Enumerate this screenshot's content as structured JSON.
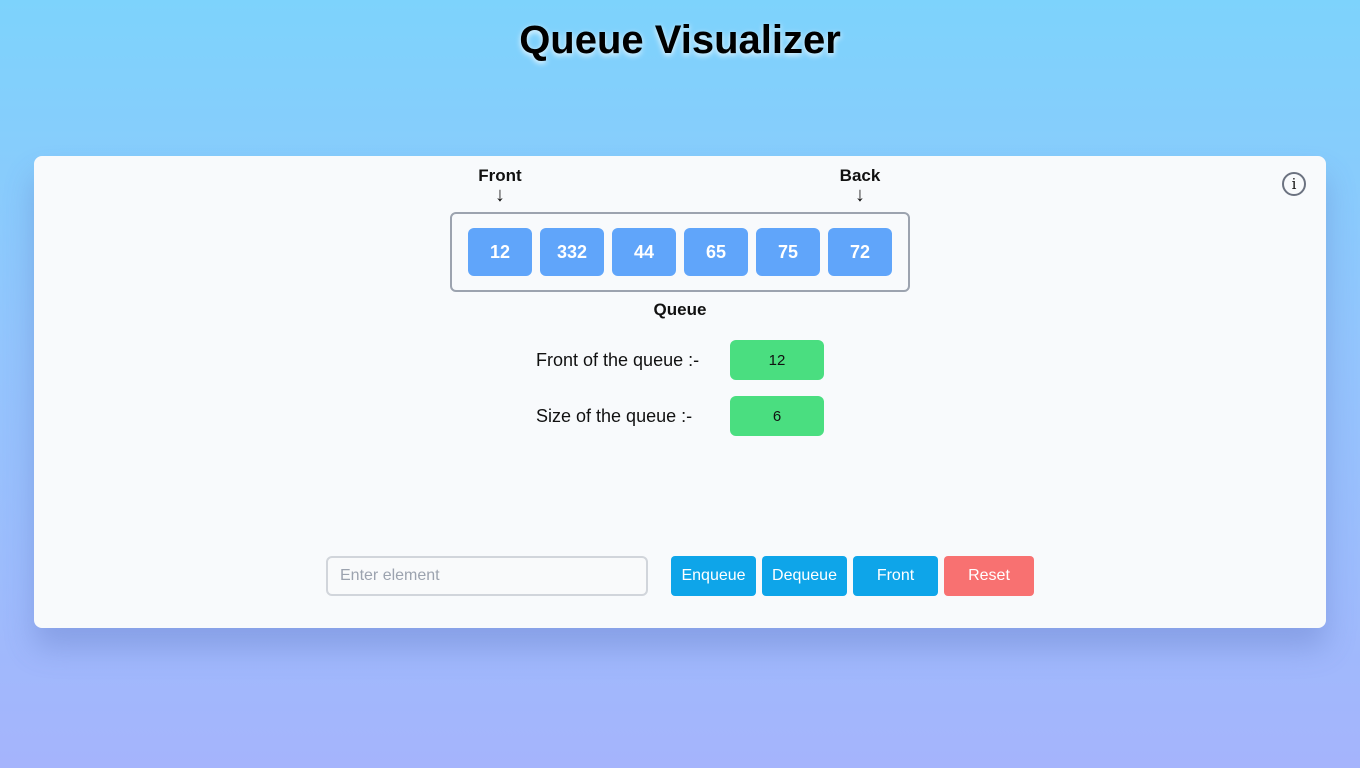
{
  "page": {
    "title": "Queue Visualizer"
  },
  "info": {
    "icon": "info-icon",
    "glyph": "i"
  },
  "pointers": {
    "front_label": "Front",
    "back_label": "Back",
    "arrow": "↓"
  },
  "queue": {
    "items": [
      "12",
      "332",
      "44",
      "65",
      "75",
      "72"
    ],
    "label": "Queue"
  },
  "stats": {
    "front_label": "Front of the queue :-",
    "front_value": "12",
    "size_label": "Size of the queue :-",
    "size_value": "6"
  },
  "controls": {
    "input_placeholder": "Enter element",
    "input_value": "",
    "enqueue_label": "Enqueue",
    "dequeue_label": "Dequeue",
    "front_label": "Front",
    "reset_label": "Reset"
  },
  "colors": {
    "queue_cell": "#60a5fa",
    "stat_value": "#4ade80",
    "action_button": "#0ea5e9",
    "reset_button": "#f87171"
  }
}
